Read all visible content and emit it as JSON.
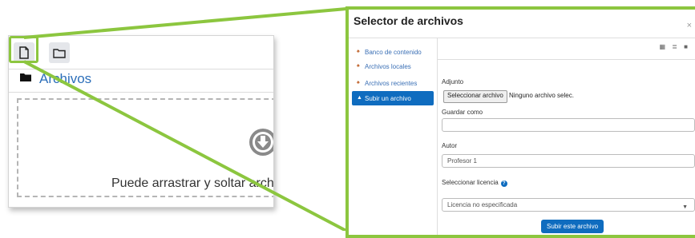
{
  "left_panel": {
    "path_label": "Archivos",
    "drop_text": "Puede arrastrar y soltar archivos"
  },
  "modal": {
    "title": "Selector de archivos",
    "close": "×",
    "repositories": [
      {
        "label": "Banco de contenido"
      },
      {
        "label": "Archivos locales"
      },
      {
        "label": "Archivos recientes"
      },
      {
        "label": "Subir un archivo",
        "active": true
      }
    ],
    "form": {
      "attachment_label": "Adjunto",
      "choose_button": "Seleccionar archivo",
      "no_file_text": "Ninguno archivo selec.",
      "save_as_label": "Guardar como",
      "save_as_value": "",
      "author_label": "Autor",
      "author_value": "Profesor 1",
      "license_label": "Seleccionar licencia",
      "license_value": "Licencia no especificada",
      "help_glyph": "?",
      "submit_button": "Subir este archivo"
    }
  },
  "colors": {
    "highlight": "#8cc63f",
    "accent": "#0f6cbf",
    "link": "#2c6fba"
  }
}
